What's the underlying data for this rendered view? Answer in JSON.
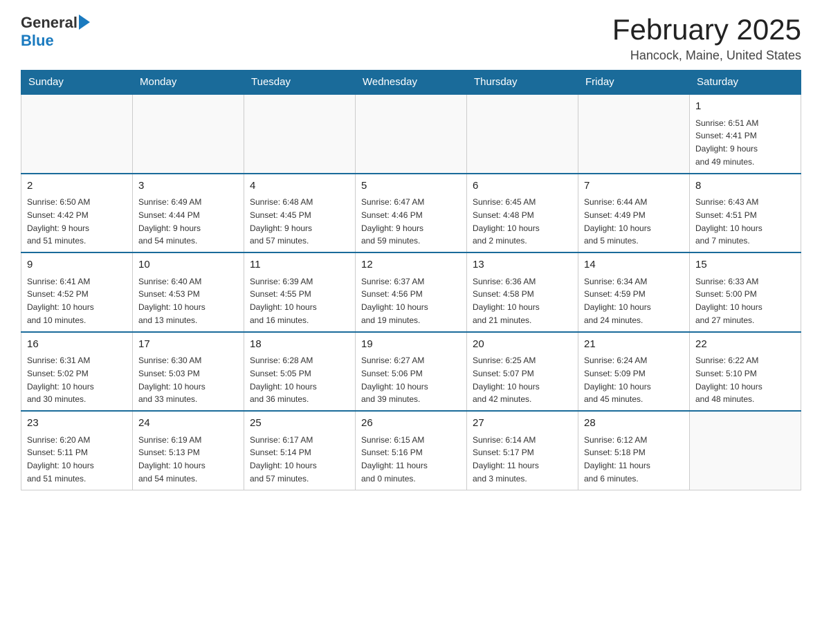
{
  "header": {
    "logo": {
      "general": "General",
      "blue": "Blue"
    },
    "title": "February 2025",
    "location": "Hancock, Maine, United States"
  },
  "weekdays": [
    "Sunday",
    "Monday",
    "Tuesday",
    "Wednesday",
    "Thursday",
    "Friday",
    "Saturday"
  ],
  "weeks": [
    [
      {
        "day": "",
        "info": ""
      },
      {
        "day": "",
        "info": ""
      },
      {
        "day": "",
        "info": ""
      },
      {
        "day": "",
        "info": ""
      },
      {
        "day": "",
        "info": ""
      },
      {
        "day": "",
        "info": ""
      },
      {
        "day": "1",
        "info": "Sunrise: 6:51 AM\nSunset: 4:41 PM\nDaylight: 9 hours\nand 49 minutes."
      }
    ],
    [
      {
        "day": "2",
        "info": "Sunrise: 6:50 AM\nSunset: 4:42 PM\nDaylight: 9 hours\nand 51 minutes."
      },
      {
        "day": "3",
        "info": "Sunrise: 6:49 AM\nSunset: 4:44 PM\nDaylight: 9 hours\nand 54 minutes."
      },
      {
        "day": "4",
        "info": "Sunrise: 6:48 AM\nSunset: 4:45 PM\nDaylight: 9 hours\nand 57 minutes."
      },
      {
        "day": "5",
        "info": "Sunrise: 6:47 AM\nSunset: 4:46 PM\nDaylight: 9 hours\nand 59 minutes."
      },
      {
        "day": "6",
        "info": "Sunrise: 6:45 AM\nSunset: 4:48 PM\nDaylight: 10 hours\nand 2 minutes."
      },
      {
        "day": "7",
        "info": "Sunrise: 6:44 AM\nSunset: 4:49 PM\nDaylight: 10 hours\nand 5 minutes."
      },
      {
        "day": "8",
        "info": "Sunrise: 6:43 AM\nSunset: 4:51 PM\nDaylight: 10 hours\nand 7 minutes."
      }
    ],
    [
      {
        "day": "9",
        "info": "Sunrise: 6:41 AM\nSunset: 4:52 PM\nDaylight: 10 hours\nand 10 minutes."
      },
      {
        "day": "10",
        "info": "Sunrise: 6:40 AM\nSunset: 4:53 PM\nDaylight: 10 hours\nand 13 minutes."
      },
      {
        "day": "11",
        "info": "Sunrise: 6:39 AM\nSunset: 4:55 PM\nDaylight: 10 hours\nand 16 minutes."
      },
      {
        "day": "12",
        "info": "Sunrise: 6:37 AM\nSunset: 4:56 PM\nDaylight: 10 hours\nand 19 minutes."
      },
      {
        "day": "13",
        "info": "Sunrise: 6:36 AM\nSunset: 4:58 PM\nDaylight: 10 hours\nand 21 minutes."
      },
      {
        "day": "14",
        "info": "Sunrise: 6:34 AM\nSunset: 4:59 PM\nDaylight: 10 hours\nand 24 minutes."
      },
      {
        "day": "15",
        "info": "Sunrise: 6:33 AM\nSunset: 5:00 PM\nDaylight: 10 hours\nand 27 minutes."
      }
    ],
    [
      {
        "day": "16",
        "info": "Sunrise: 6:31 AM\nSunset: 5:02 PM\nDaylight: 10 hours\nand 30 minutes."
      },
      {
        "day": "17",
        "info": "Sunrise: 6:30 AM\nSunset: 5:03 PM\nDaylight: 10 hours\nand 33 minutes."
      },
      {
        "day": "18",
        "info": "Sunrise: 6:28 AM\nSunset: 5:05 PM\nDaylight: 10 hours\nand 36 minutes."
      },
      {
        "day": "19",
        "info": "Sunrise: 6:27 AM\nSunset: 5:06 PM\nDaylight: 10 hours\nand 39 minutes."
      },
      {
        "day": "20",
        "info": "Sunrise: 6:25 AM\nSunset: 5:07 PM\nDaylight: 10 hours\nand 42 minutes."
      },
      {
        "day": "21",
        "info": "Sunrise: 6:24 AM\nSunset: 5:09 PM\nDaylight: 10 hours\nand 45 minutes."
      },
      {
        "day": "22",
        "info": "Sunrise: 6:22 AM\nSunset: 5:10 PM\nDaylight: 10 hours\nand 48 minutes."
      }
    ],
    [
      {
        "day": "23",
        "info": "Sunrise: 6:20 AM\nSunset: 5:11 PM\nDaylight: 10 hours\nand 51 minutes."
      },
      {
        "day": "24",
        "info": "Sunrise: 6:19 AM\nSunset: 5:13 PM\nDaylight: 10 hours\nand 54 minutes."
      },
      {
        "day": "25",
        "info": "Sunrise: 6:17 AM\nSunset: 5:14 PM\nDaylight: 10 hours\nand 57 minutes."
      },
      {
        "day": "26",
        "info": "Sunrise: 6:15 AM\nSunset: 5:16 PM\nDaylight: 11 hours\nand 0 minutes."
      },
      {
        "day": "27",
        "info": "Sunrise: 6:14 AM\nSunset: 5:17 PM\nDaylight: 11 hours\nand 3 minutes."
      },
      {
        "day": "28",
        "info": "Sunrise: 6:12 AM\nSunset: 5:18 PM\nDaylight: 11 hours\nand 6 minutes."
      },
      {
        "day": "",
        "info": ""
      }
    ]
  ]
}
